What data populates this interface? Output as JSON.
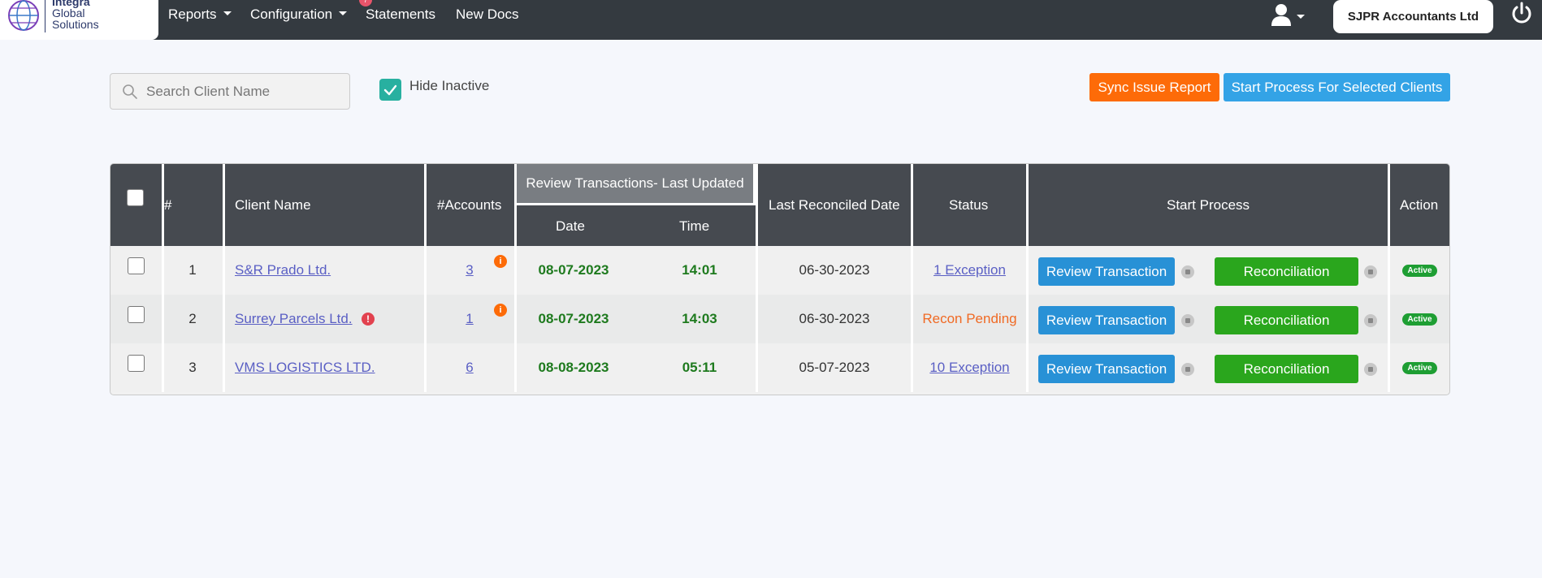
{
  "brand": {
    "line1": "Integra",
    "line2": "Global",
    "line3": "Solutions"
  },
  "nav": {
    "items": [
      {
        "label": "Reports",
        "dropdown": true
      },
      {
        "label": "Configuration",
        "dropdown": true
      },
      {
        "label": "Statements",
        "dropdown": false
      },
      {
        "label": "New Docs",
        "dropdown": false
      }
    ],
    "company": "SJPR Accountants Ltd"
  },
  "toolbar": {
    "search_placeholder": "Search Client Name",
    "hide_inactive_label": "Hide Inactive",
    "hide_inactive_checked": true,
    "sync_label": "Sync Issue Report",
    "start_label": "Start Process For Selected Clients"
  },
  "table": {
    "headers": {
      "num": "#",
      "client": "Client Name",
      "accounts": "#Accounts",
      "review_group": "Review Transactions- Last Updated",
      "date": "Date",
      "time": "Time",
      "last_reconciled": "Last Reconciled Date",
      "status": "Status",
      "start_process": "Start Process",
      "action": "Action"
    },
    "rows": [
      {
        "num": "1",
        "client": "S&R Prado Ltd.",
        "client_warning": false,
        "accounts": "3",
        "accounts_info": true,
        "date": "08-07-2023",
        "time": "14:01",
        "last_reconciled": "06-30-2023",
        "status": "1 Exception",
        "status_type": "link",
        "review_label": "Review Transaction",
        "recon_label": "Reconciliation",
        "action": "Active"
      },
      {
        "num": "2",
        "client": "Surrey Parcels Ltd.",
        "client_warning": true,
        "accounts": "1",
        "accounts_info": true,
        "date": "08-07-2023",
        "time": "14:03",
        "last_reconciled": "06-30-2023",
        "status": "Recon Pending",
        "status_type": "pending",
        "review_label": "Review Transaction",
        "recon_label": "Reconciliation",
        "action": "Active"
      },
      {
        "num": "3",
        "client": "VMS LOGISTICS LTD.",
        "client_warning": false,
        "accounts": "6",
        "accounts_info": false,
        "date": "08-08-2023",
        "time": "05:11",
        "last_reconciled": "05-07-2023",
        "status": "10 Exception",
        "status_type": "link",
        "review_label": "Review Transaction",
        "recon_label": "Reconciliation",
        "action": "Active"
      }
    ]
  },
  "colors": {
    "navbar": "#343a40",
    "sync": "#fd6b08",
    "start": "#33a3e6",
    "review": "#2891d6",
    "recon": "#2aa61d",
    "active_badge": "#1e9e33"
  }
}
